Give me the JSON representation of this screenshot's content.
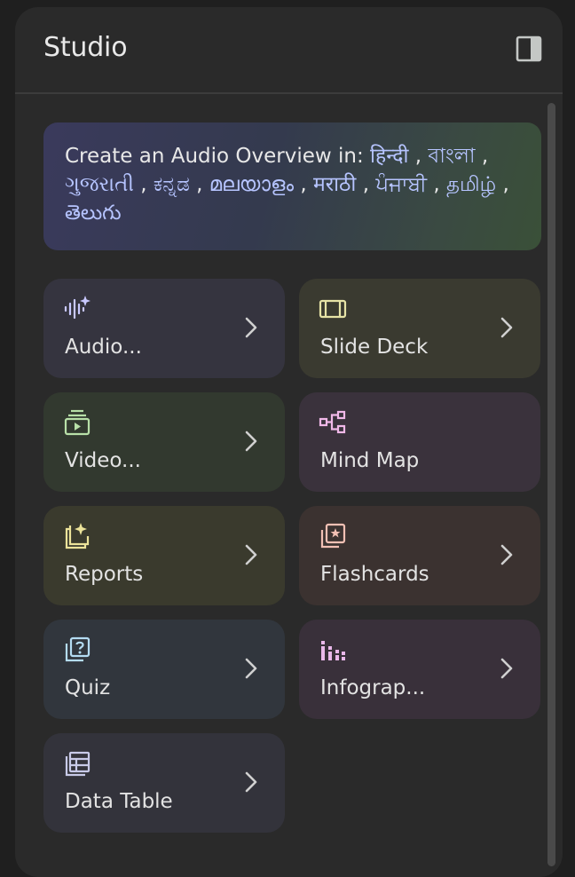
{
  "panel": {
    "title": "Studio",
    "collapse_icon": "side-panel-icon"
  },
  "banner": {
    "prefix": "Create an Audio Overview in:",
    "languages": [
      "हिन्दी",
      "বাংলা",
      "ગુજરાતી",
      "ಕನ್ನಡ",
      "മലയാളം",
      "मराठी",
      "ਪੰਜਾਬੀ",
      "தமிழ்",
      "తెలుగు"
    ],
    "separator": ","
  },
  "tiles": [
    {
      "label": "Audio...",
      "icon": "audio-sparkle-icon",
      "has_chevron": true,
      "bg": "#35343f",
      "icon_color": "#c9c9ff"
    },
    {
      "label": "Slide Deck",
      "icon": "slides-icon",
      "has_chevron": true,
      "bg": "#3a3a30",
      "icon_color": "#e6e3a6"
    },
    {
      "label": "Video...",
      "icon": "video-icon",
      "has_chevron": true,
      "bg": "#32392f",
      "icon_color": "#b8e0a8"
    },
    {
      "label": "Mind Map",
      "icon": "mind-map-icon",
      "has_chevron": false,
      "bg": "#3a323c",
      "icon_color": "#f0b8e8"
    },
    {
      "label": "Reports",
      "icon": "reports-sparkle-icon",
      "has_chevron": true,
      "bg": "#3a3a2d",
      "icon_color": "#ece39a"
    },
    {
      "label": "Flashcards",
      "icon": "flashcards-icon",
      "has_chevron": true,
      "bg": "#3b3230",
      "icon_color": "#f2c0b4"
    },
    {
      "label": "Quiz",
      "icon": "quiz-icon",
      "has_chevron": true,
      "bg": "#31363d",
      "icon_color": "#b4dcf2"
    },
    {
      "label": "Infograp...",
      "icon": "infographic-icon",
      "has_chevron": true,
      "bg": "#39303a",
      "icon_color": "#eab8ea"
    },
    {
      "label": "Data Table",
      "icon": "table-icon",
      "has_chevron": true,
      "bg": "#33333b",
      "icon_color": "#c8cae8"
    }
  ]
}
